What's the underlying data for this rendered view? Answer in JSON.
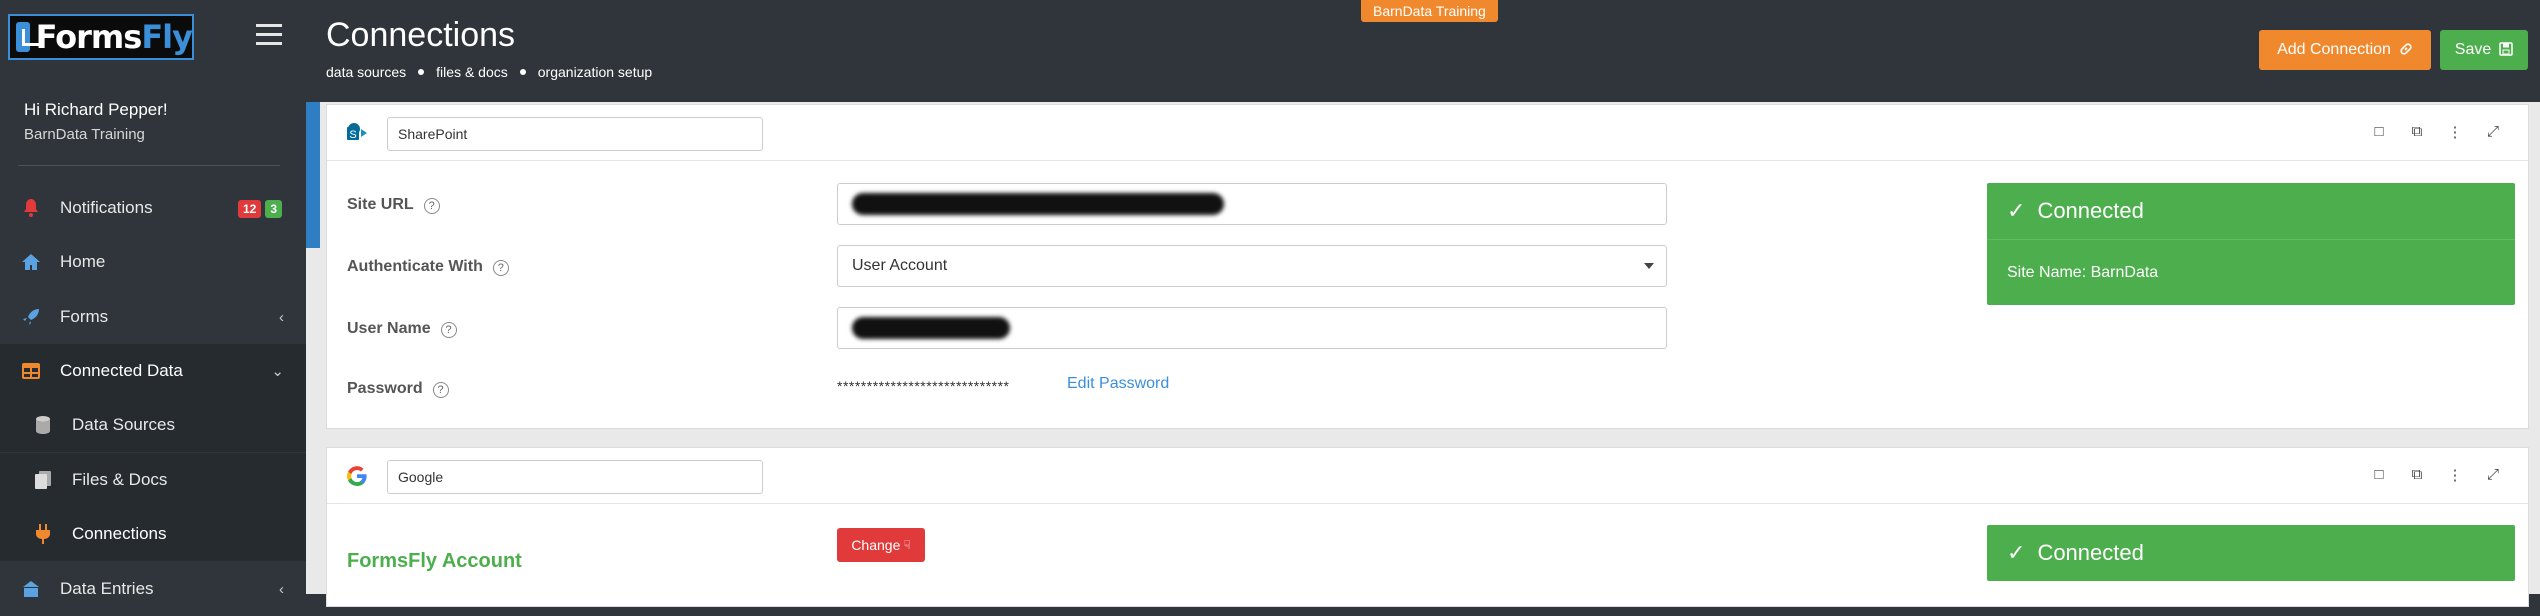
{
  "app": {
    "logo_main": "Forms",
    "logo_accent": "Fly"
  },
  "user": {
    "greeting": "Hi Richard Pepper!",
    "org": "BarnData Training"
  },
  "nav": {
    "notifications": {
      "label": "Notifications",
      "badge_red": "12",
      "badge_green": "3"
    },
    "home": {
      "label": "Home"
    },
    "forms": {
      "label": "Forms"
    },
    "connected_data": {
      "label": "Connected Data"
    },
    "data_sources": {
      "label": "Data Sources"
    },
    "files_docs": {
      "label": "Files & Docs"
    },
    "connections": {
      "label": "Connections"
    },
    "data_entries": {
      "label": "Data Entries"
    }
  },
  "header": {
    "title": "Connections",
    "crumbs": [
      "data sources",
      "files & docs",
      "organization setup"
    ],
    "org_badge": "BarnData Training",
    "add_connection": "Add Connection",
    "save": "Save"
  },
  "sharepoint": {
    "name": "SharePoint",
    "site_url_label": "Site URL",
    "auth_label": "Authenticate With",
    "auth_value": "User Account",
    "username_label": "User Name",
    "password_label": "Password",
    "password_mask": "*****************************",
    "edit_password": "Edit Password",
    "status": "Connected",
    "site_name": "Site Name: BarnData"
  },
  "google": {
    "name": "Google",
    "section_title": "FormsFly Account",
    "change": "Change",
    "status": "Connected"
  },
  "colors": {
    "accent_orange": "#f0892e",
    "success_green": "#4cae4c",
    "danger_red": "#e03a3a",
    "link_blue": "#3b8fd9"
  }
}
